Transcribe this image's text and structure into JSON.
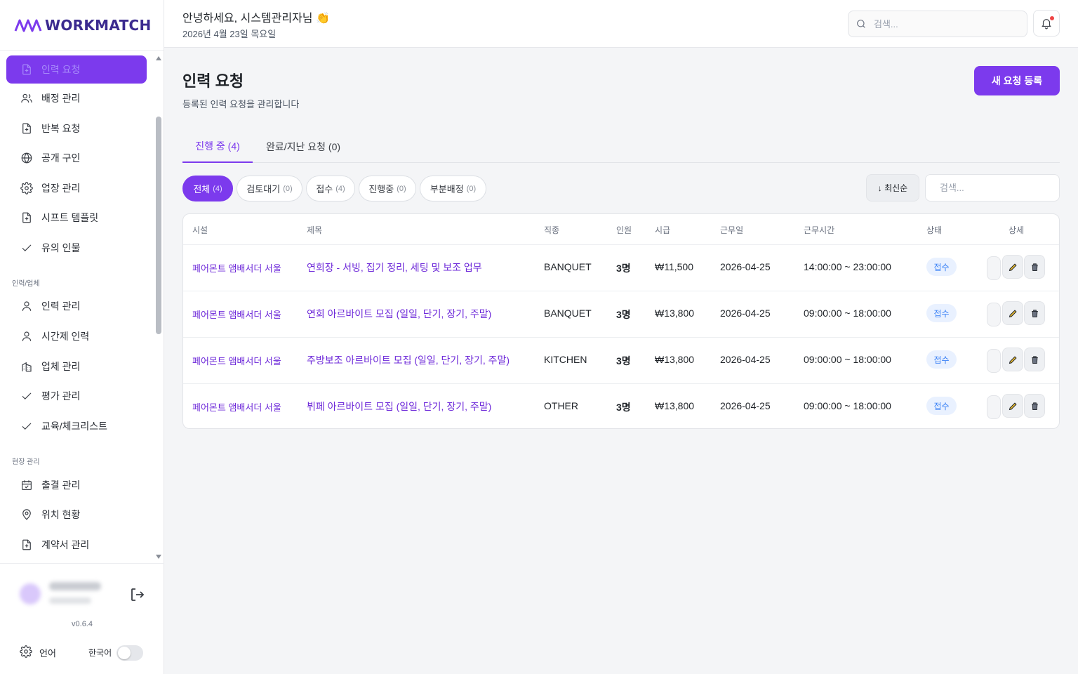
{
  "brand": {
    "name": "WORKMATCH"
  },
  "sidebar": {
    "items": [
      {
        "label": "인력 요청",
        "icon": "file-plus-icon",
        "active": true
      },
      {
        "label": "배정 관리",
        "icon": "users-icon"
      },
      {
        "label": "반복 요청",
        "icon": "file-plus-icon"
      },
      {
        "label": "공개 구인",
        "icon": "globe-icon"
      },
      {
        "label": "업장 관리",
        "icon": "gear-icon"
      },
      {
        "label": "시프트 템플릿",
        "icon": "file-plus-icon"
      },
      {
        "label": "유의 인물",
        "icon": "check-icon"
      }
    ],
    "section_workforce": "인력/업체",
    "workforce_items": [
      {
        "label": "인력 관리",
        "icon": "user-icon"
      },
      {
        "label": "시간제 인력",
        "icon": "user-icon"
      },
      {
        "label": "업체 관리",
        "icon": "building-icon"
      },
      {
        "label": "평가 관리",
        "icon": "check-icon"
      },
      {
        "label": "교육/체크리스트",
        "icon": "check-icon"
      }
    ],
    "section_site": "현장 관리",
    "site_items": [
      {
        "label": "출결 관리",
        "icon": "calendar-icon"
      },
      {
        "label": "위치 현황",
        "icon": "map-pin-icon"
      },
      {
        "label": "계약서 관리",
        "icon": "file-plus-icon"
      }
    ],
    "version": "v0.6.4",
    "language_label": "언어",
    "language_value": "한국어"
  },
  "header": {
    "greeting": "안녕하세요, 시스템관리자님 👏",
    "date": "2026년 4월 23일 목요일",
    "search_placeholder": "검색..."
  },
  "page": {
    "title": "인력 요청",
    "subtitle": "등록된 인력 요청을 관리합니다",
    "new_button": "새 요청 등록"
  },
  "tabs": [
    {
      "label": "진행 중 (4)",
      "active": true
    },
    {
      "label": "완료/지난 요청 (0)",
      "active": false
    }
  ],
  "filters": [
    {
      "label": "전체",
      "count": "(4)",
      "active": true
    },
    {
      "label": "검토대기",
      "count": "(0)"
    },
    {
      "label": "접수",
      "count": "(4)"
    },
    {
      "label": "진행중",
      "count": "(0)"
    },
    {
      "label": "부분배정",
      "count": "(0)"
    }
  ],
  "sort_label": "↓ 최신순",
  "table_search_placeholder": "검색...",
  "table": {
    "columns": [
      "시설",
      "제목",
      "직종",
      "인원",
      "시급",
      "근무일",
      "근무시간",
      "상태",
      "상세"
    ],
    "rows": [
      {
        "facility": "페어몬트 앰배서더 서울",
        "title": "연회장 - 서빙, 집기 정리, 세팅 및 보조 업무",
        "job": "BANQUET",
        "count": "3명",
        "wage": "₩11,500",
        "date": "2026-04-25",
        "time": "14:00:00 ~ 23:00:00",
        "status": "접수"
      },
      {
        "facility": "페어몬트 앰배서더 서울",
        "title": "연회 아르바이트 모집 (일일, 단기, 장기, 주말)",
        "job": "BANQUET",
        "count": "3명",
        "wage": "₩13,800",
        "date": "2026-04-25",
        "time": "09:00:00 ~ 18:00:00",
        "status": "접수"
      },
      {
        "facility": "페어몬트 앰배서더 서울",
        "title": "주방보조 아르바이트 모집 (일일, 단기, 장기, 주말)",
        "job": "KITCHEN",
        "count": "3명",
        "wage": "₩13,800",
        "date": "2026-04-25",
        "time": "09:00:00 ~ 18:00:00",
        "status": "접수"
      },
      {
        "facility": "페어몬트 앰배서더 서울",
        "title": "뷔페 아르바이트 모집 (일일, 단기, 장기, 주말)",
        "job": "OTHER",
        "count": "3명",
        "wage": "₩13,800",
        "date": "2026-04-25",
        "time": "09:00:00 ~ 18:00:00",
        "status": "접수"
      }
    ]
  },
  "colors": {
    "accent": "#7c3aed",
    "status_bg": "#e9f1ff",
    "status_text": "#3b82f6",
    "link": "#6d28d9"
  }
}
